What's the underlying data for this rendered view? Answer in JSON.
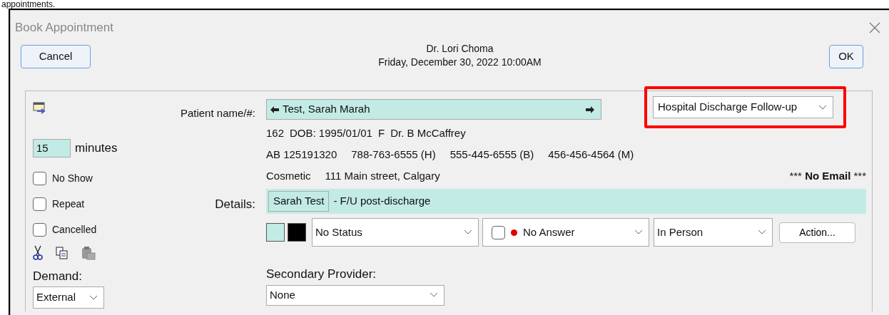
{
  "caption_fragment": "appointments.",
  "window": {
    "title": "Book Appointment"
  },
  "header": {
    "cancel": "Cancel",
    "provider": "Dr. Lori Choma",
    "datetime": "Friday, December 30, 2022 10:00AM",
    "ok": "OK"
  },
  "duration": {
    "value": "15",
    "unit": "minutes"
  },
  "flags": [
    {
      "label": "No Show",
      "checked": false
    },
    {
      "label": "Repeat",
      "checked": false
    },
    {
      "label": "Cancelled",
      "checked": false
    }
  ],
  "demand": {
    "label": "Demand:",
    "value": "External"
  },
  "patient": {
    "label": "Patient name/#:",
    "name": "Test, Sarah Marah"
  },
  "info_lines": [
    [
      "162",
      "DOB: 1995/01/01",
      "F",
      "Dr. B McCaffrey"
    ],
    [
      "AB 125191320",
      "788-763-6555 (H)",
      "555-445-6555 (B)",
      "456-456-4564 (M)"
    ],
    [
      "Cosmetic",
      "111 Main street, Calgary"
    ]
  ],
  "email_notice": {
    "prefix": "***",
    "emphasis": "No Email",
    "suffix": "***"
  },
  "appointment_type": {
    "value": "Hospital Discharge Follow-up",
    "highlighted": true
  },
  "details": {
    "label": "Details:",
    "tag": "Sarah Test",
    "text": "- F/U post-discharge"
  },
  "swatches": [
    {
      "color": "#c2ebe5"
    },
    {
      "color": "#000000"
    }
  ],
  "status": {
    "value": "No Status"
  },
  "answer": {
    "checked": false,
    "color": "#e00000",
    "value": "No Answer"
  },
  "visit_mode": {
    "value": "In Person"
  },
  "action_button": "Action...",
  "secondary_provider": {
    "label": "Secondary Provider:",
    "value": "None"
  }
}
